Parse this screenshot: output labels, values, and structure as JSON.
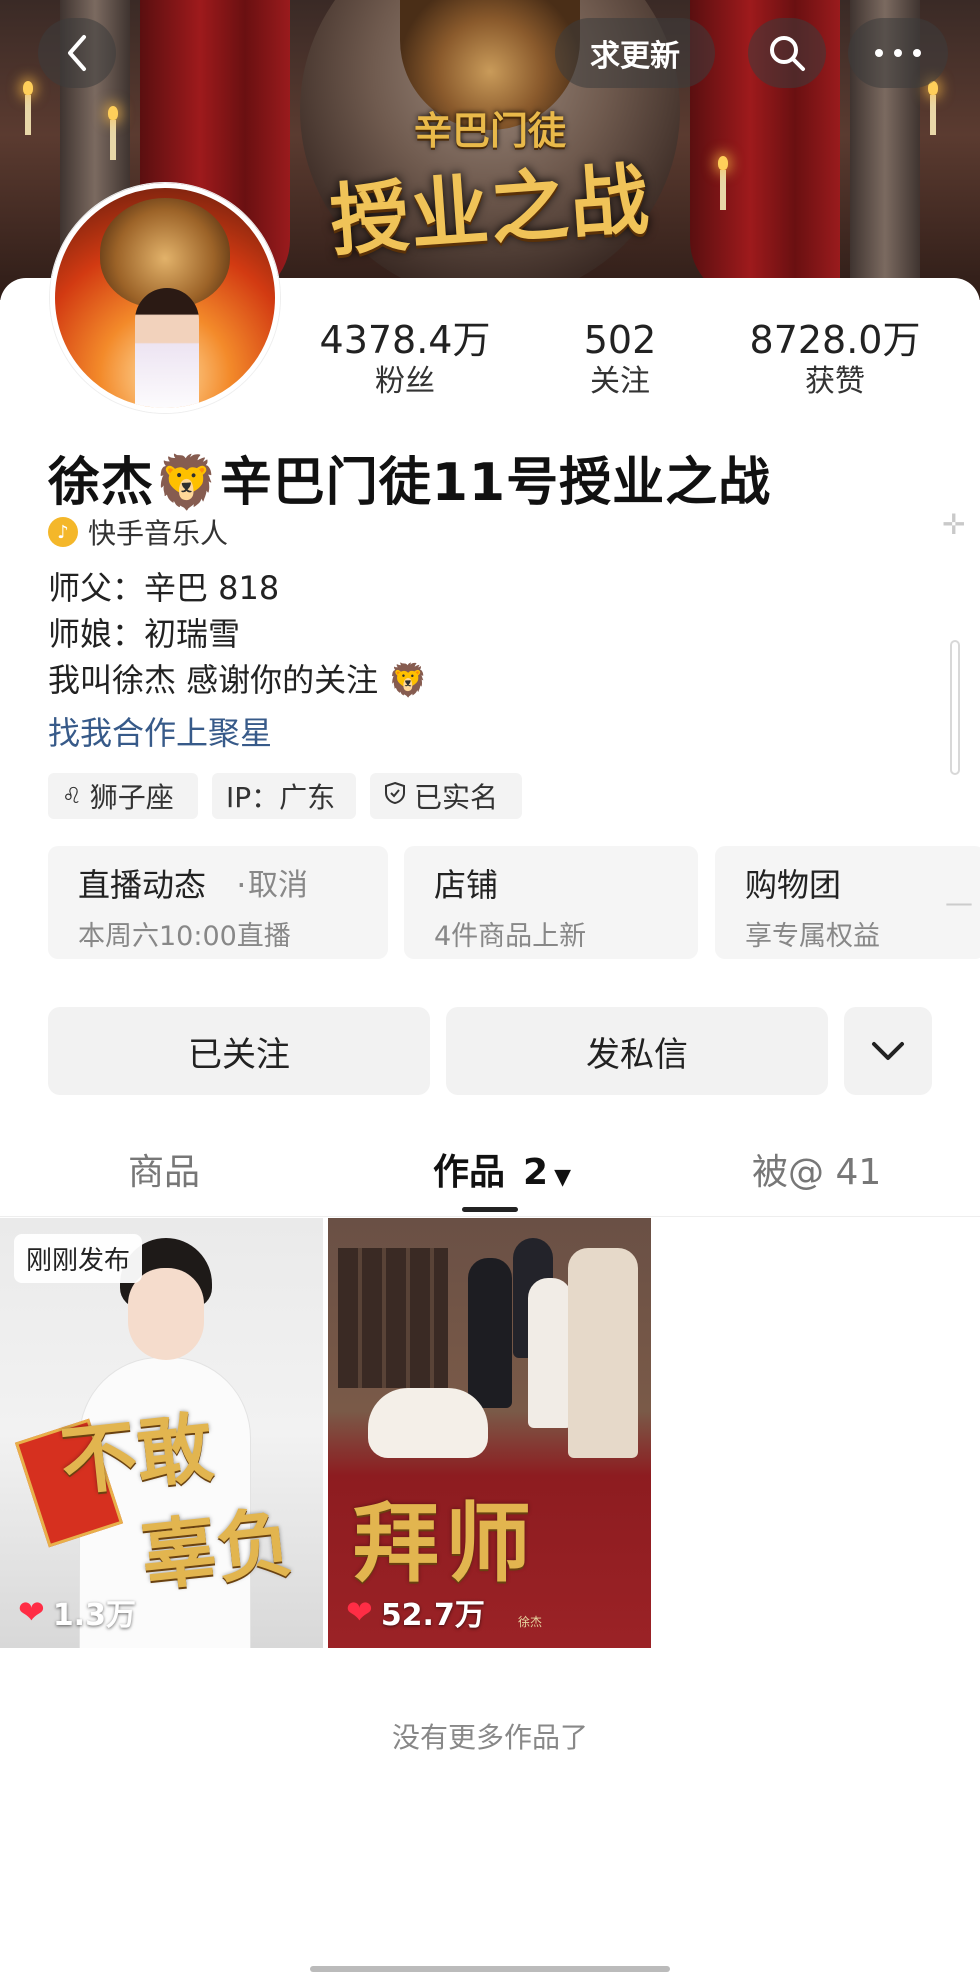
{
  "header": {
    "update_label": "求更新",
    "banner_title_small": "辛巴门徒",
    "banner_title_big": "授业之战"
  },
  "profile": {
    "name": "徐杰🦁辛巴门徒11号授业之战",
    "musician_label": "快手音乐人",
    "bio": [
      "师父：辛巴  818",
      "师娘：初瑞雪",
      "我叫徐杰  感谢你的关注  🦁"
    ],
    "coop_link": "找我合作上聚星"
  },
  "stats": [
    {
      "value": "4378.4万",
      "label": "粉丝"
    },
    {
      "value": "502",
      "label": "关注"
    },
    {
      "value": "8728.0万",
      "label": "获赞"
    }
  ],
  "tags": [
    "狮子座",
    "IP：广东",
    "已实名"
  ],
  "features": {
    "live": {
      "title": "直播动态",
      "dot": "·",
      "cancel": "取消",
      "subtitle": "本周六10:00直播"
    },
    "shop": {
      "title": "店铺",
      "subtitle": "4件商品上新"
    },
    "group": {
      "title": "购物团",
      "subtitle": "享专属权益"
    }
  },
  "actions": {
    "followed": "已关注",
    "message": "发私信"
  },
  "tabs": {
    "goods": "商品",
    "works": "作品",
    "works_count": "2",
    "mentions": "被@  41"
  },
  "videos": [
    {
      "badge": "刚刚发布",
      "title_a": "不敢",
      "title_b": "辜负",
      "likes": "1.3万"
    },
    {
      "title": "拜师",
      "watermark": "徐杰",
      "likes": "52.7万"
    }
  ],
  "footer_text": "没有更多作品了",
  "icons": {
    "back": "chevron-left-icon",
    "search": "search-icon",
    "more": "more-dots-icon",
    "add": "plus-icon",
    "music": "music-note-icon",
    "zodiac": "zodiac-icon",
    "verified": "shield-check-icon",
    "expand": "chevron-down-icon",
    "heart": "heart-icon"
  },
  "colors": {
    "link": "#375a89",
    "heart": "#ff2d45",
    "musician_badge": "#f4b72a"
  }
}
